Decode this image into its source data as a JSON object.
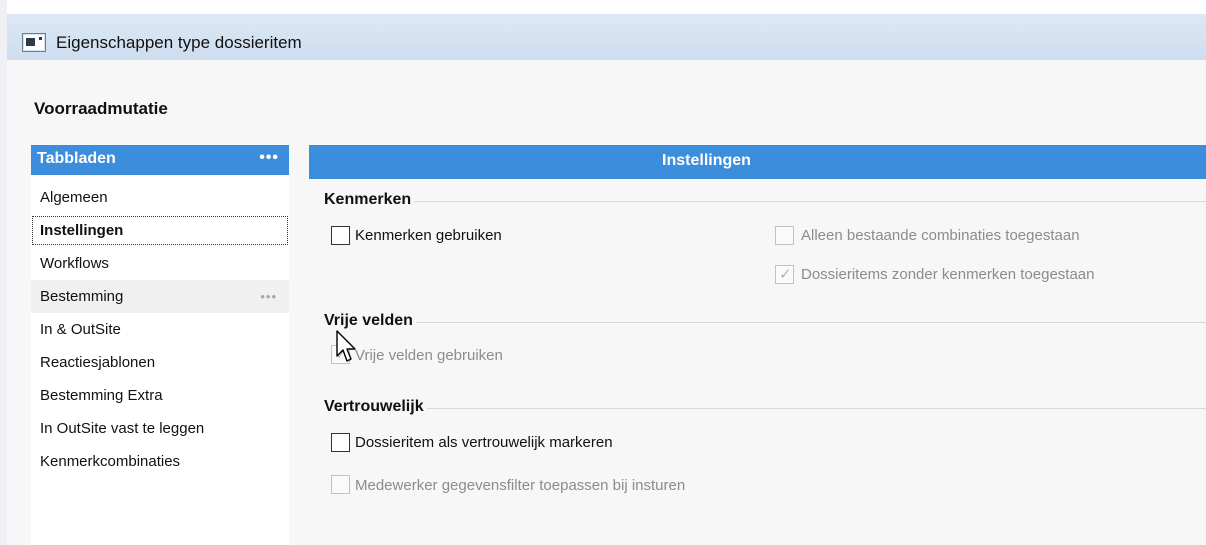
{
  "window": {
    "title": "Eigenschappen type dossieritem",
    "icon": "window-icon"
  },
  "document": {
    "title": "Voorraadmutatie"
  },
  "sidebar": {
    "header": "Tabbladen",
    "more": "•••",
    "items": [
      {
        "label": "Algemeen"
      },
      {
        "label": "Instellingen",
        "selected": true
      },
      {
        "label": "Workflows"
      },
      {
        "label": "Bestemming",
        "more": "•••"
      },
      {
        "label": "In & OutSite"
      },
      {
        "label": "Reactiesjablonen"
      },
      {
        "label": "Bestemming Extra"
      },
      {
        "label": "In OutSite vast te leggen"
      },
      {
        "label": "Kenmerkcombinaties"
      }
    ]
  },
  "panel": {
    "header": "Instellingen",
    "groups": {
      "kenmerken": {
        "title": "Kenmerken",
        "use_label": "Kenmerken gebruiken",
        "use_checked": false,
        "only_existing_label": "Alleen bestaande combinaties toegestaan",
        "only_existing_checked": false,
        "only_existing_enabled": false,
        "without_label": "Dossieritems zonder kenmerken toegestaan",
        "without_checked": true,
        "without_enabled": false
      },
      "vrije_velden": {
        "title": "Vrije velden",
        "use_label": "Vrije velden gebruiken",
        "use_checked": true,
        "use_enabled": false
      },
      "vertrouwelijk": {
        "title": "Vertrouwelijk",
        "mark_label": "Dossieritem als vertrouwelijk markeren",
        "mark_checked": false,
        "filter_label": "Medewerker gegevensfilter toepassen bij insturen",
        "filter_checked": false,
        "filter_enabled": false
      }
    }
  },
  "colors": {
    "accent": "#3d8ddd",
    "titlebar": "#c9dbef",
    "background": "#f7f7f8"
  }
}
